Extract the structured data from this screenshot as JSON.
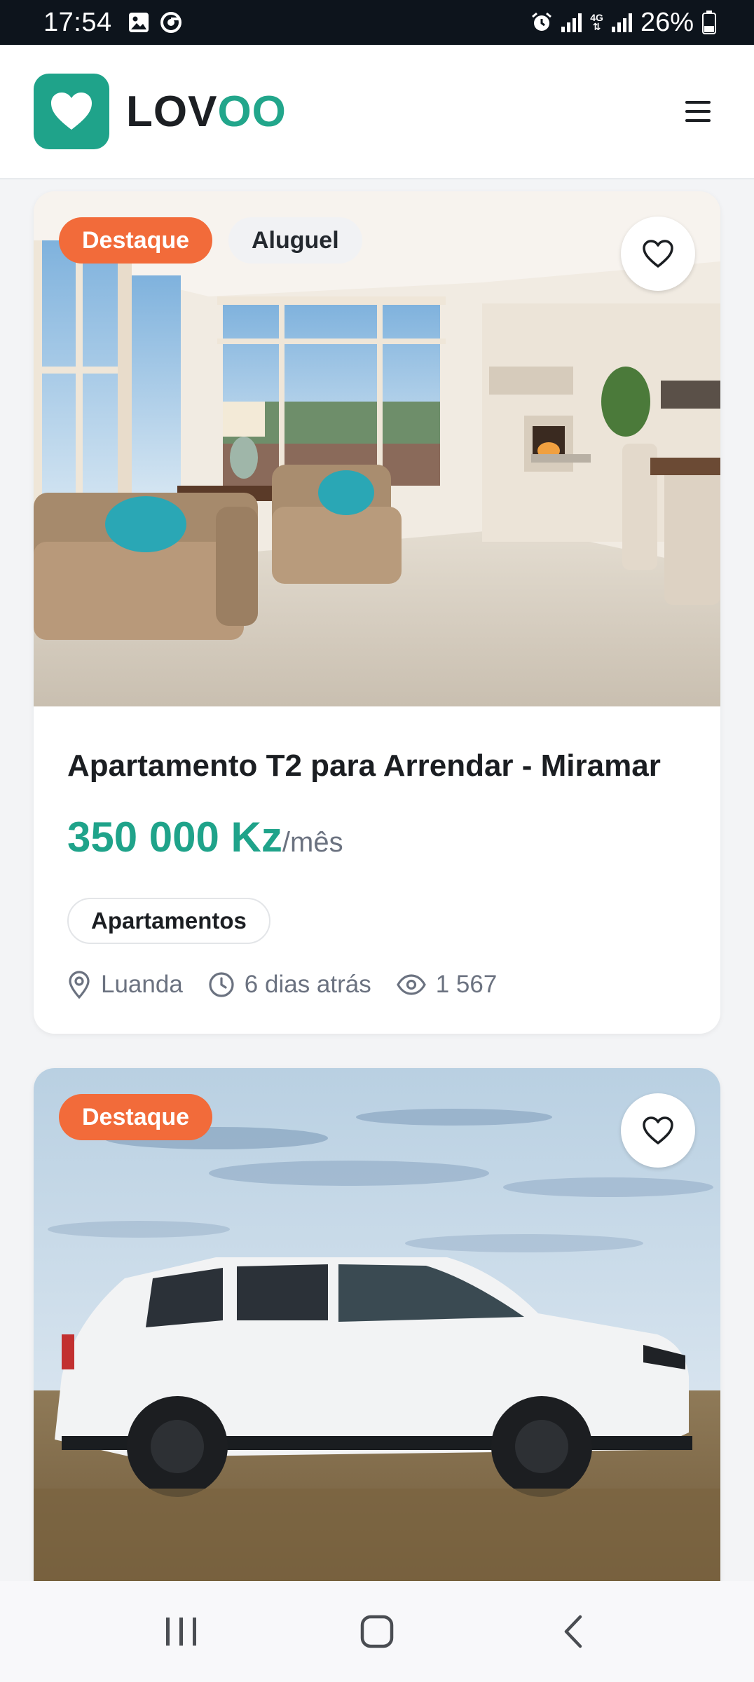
{
  "status_bar": {
    "time": "17:54",
    "network": "4G",
    "battery": "26%"
  },
  "header": {
    "logo_part1": "LOV",
    "logo_part2": "OO",
    "menu_icon": "hamburger-menu-icon"
  },
  "listings": [
    {
      "badges": [
        "Destaque",
        "Aluguel"
      ],
      "photo": "living-room-photo",
      "title": "Apartamento T2 para Arrendar - Miramar",
      "price": "350 000 Kz",
      "price_unit": "/mês",
      "category": "Apartamentos",
      "location": "Luanda",
      "posted": "6 dias atrás",
      "views": "1 567"
    },
    {
      "badges": [
        "Destaque"
      ],
      "photo": "white-suv-photo"
    }
  ],
  "colors": {
    "brand": "#1fa38a",
    "highlight_badge": "#f26b3a"
  }
}
